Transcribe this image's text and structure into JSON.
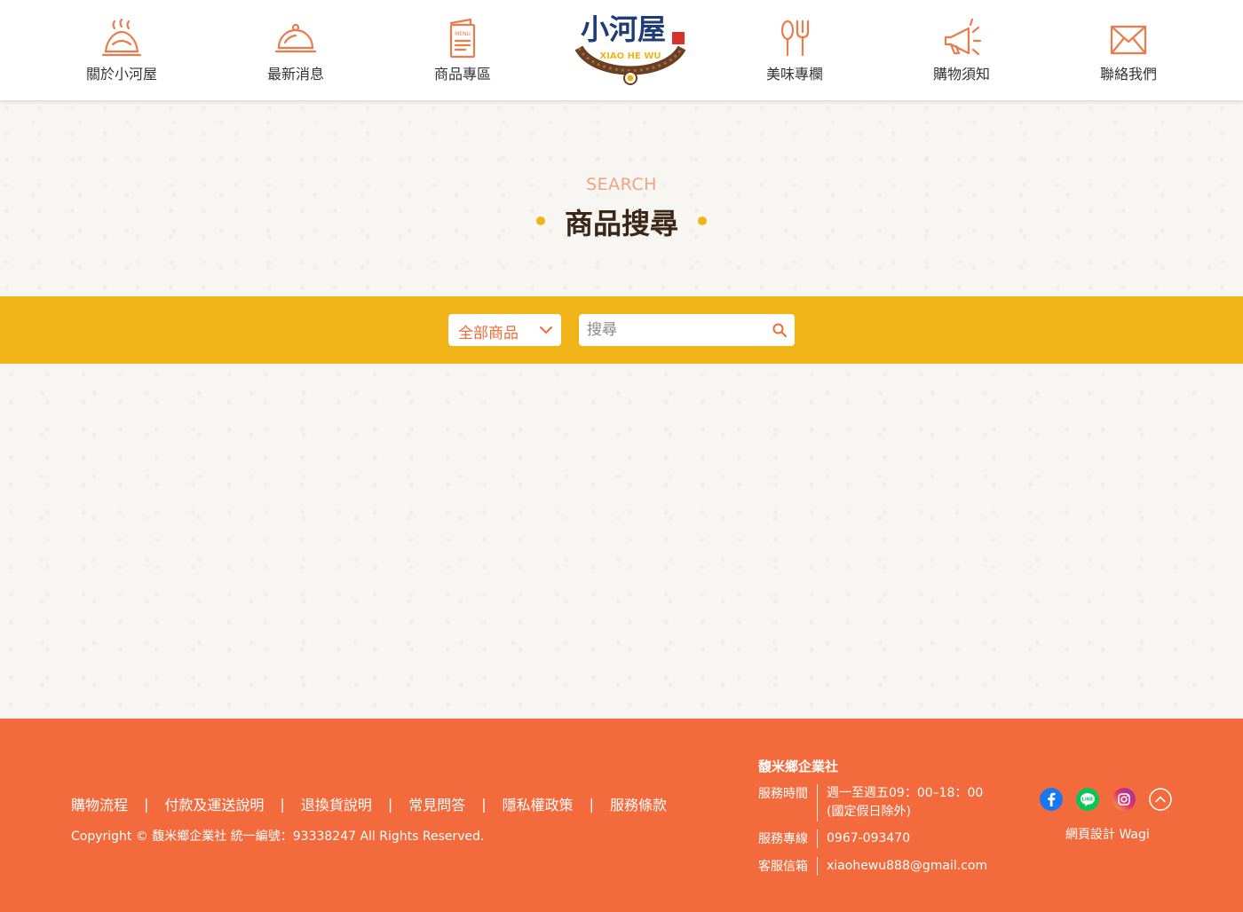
{
  "nav": {
    "left": [
      {
        "label": "關於小河屋",
        "icon": "steaming-dish-icon"
      },
      {
        "label": "最新消息",
        "icon": "cloche-icon"
      },
      {
        "label": "商品專區",
        "icon": "menu-book-icon"
      }
    ],
    "right": [
      {
        "label": "美味專欄",
        "icon": "spoon-fork-icon"
      },
      {
        "label": "購物須知",
        "icon": "megaphone-icon"
      },
      {
        "label": "聯絡我們",
        "icon": "envelope-icon"
      }
    ],
    "logo": {
      "brand": "小河屋",
      "romanized": "XIAO HE WU"
    }
  },
  "hero": {
    "subtitle": "SEARCH",
    "title": "商品搜尋"
  },
  "search": {
    "category_selected": "全部商品",
    "placeholder": "搜尋"
  },
  "footer": {
    "links": [
      "購物流程",
      "付款及運送說明",
      "退換貨說明",
      "常見問答",
      "隱私權政策",
      "服務條款"
    ],
    "separator": "|",
    "copyright": "Copyright © 馥米鄉企業社 統一編號：93338247 All Rights Reserved.",
    "company": "馥米鄉企業社",
    "service_hours_label": "服務時間",
    "service_hours_line1": "週一至週五09：00–18：00",
    "service_hours_line2": "(國定假日除外)",
    "hotline_label": "服務專線",
    "hotline": "0967-093470",
    "email_label": "客服信箱",
    "email": "xiaohewu888@gmail.com",
    "designer": "網頁設計 Wagi"
  },
  "colors": {
    "accent_orange": "#f36a3d",
    "accent_yellow": "#f1b418",
    "title_brown": "#3b2617",
    "icon_orange": "#ec7a4b"
  }
}
